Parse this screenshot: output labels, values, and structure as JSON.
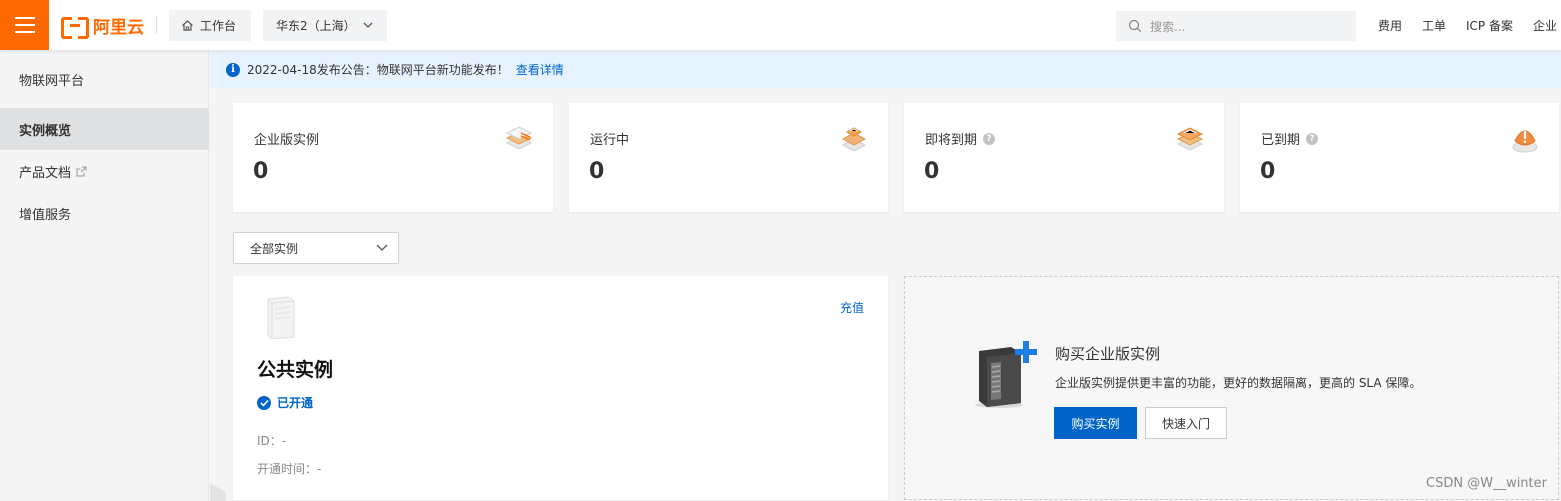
{
  "topbar": {
    "logo_text": "阿里云",
    "workbench_label": "工作台",
    "region_label": "华东2（上海）",
    "search_placeholder": "搜索...",
    "nav": [
      "费用",
      "工单",
      "ICP 备案",
      "企业"
    ],
    "accent_color": "#ff6a00"
  },
  "sidebar": {
    "title": "物联网平台",
    "items": [
      {
        "label": "实例概览",
        "active": true
      },
      {
        "label": "产品文档",
        "external": true
      },
      {
        "label": "增值服务"
      }
    ]
  },
  "notice": {
    "text": "2022-04-18发布公告：物联网平台新功能发布！",
    "link": "查看详情"
  },
  "stats": [
    {
      "label": "企业版实例",
      "value": "0",
      "help": false,
      "icon": "stack-icon"
    },
    {
      "label": "运行中",
      "value": "0",
      "help": false,
      "icon": "running-stack-icon"
    },
    {
      "label": "即将到期",
      "value": "0",
      "help": true,
      "icon": "expiring-stack-icon"
    },
    {
      "label": "已到期",
      "value": "0",
      "help": true,
      "icon": "expired-alert-icon"
    }
  ],
  "filter": {
    "selected": "全部实例"
  },
  "public_instance": {
    "recharge_label": "充值",
    "name": "公共实例",
    "status": "已开通",
    "id_label": "ID：-",
    "opened_label": "开通时间：-"
  },
  "buy_card": {
    "title": "购买企业版实例",
    "description": "企业版实例提供更丰富的功能，更好的数据隔离，更高的 SLA 保障。",
    "buy_button": "购买实例",
    "quickstart_button": "快速入门"
  },
  "watermark": "CSDN @W__winter",
  "colors": {
    "primary": "#0064c8",
    "notice_bg": "#e6f3ff"
  }
}
